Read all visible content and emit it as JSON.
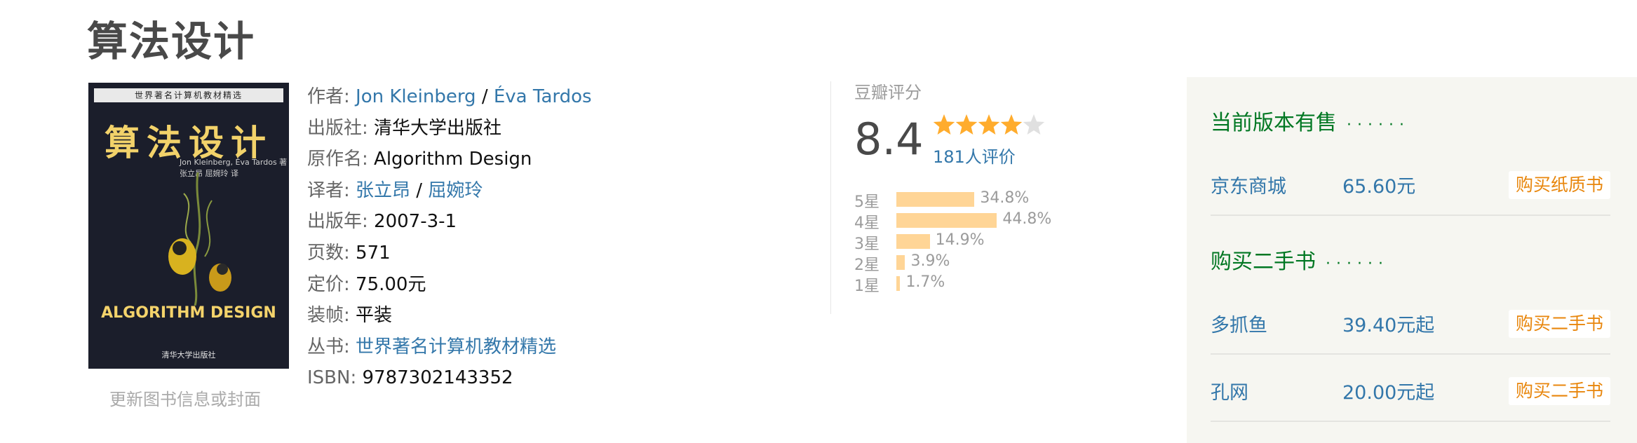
{
  "book": {
    "title": "算法设计"
  },
  "cover": {
    "series_strip": "世界著名计算机教材精选",
    "cn_title": "算法设计",
    "authors_line1": "Jon Kleinberg, Éva Tardos 著",
    "authors_line2": "张立昂 屈婉玲 译",
    "en_title": "ALGORITHM DESIGN",
    "publisher": "清华大学出版社"
  },
  "update_link": "更新图书信息或封面",
  "info": {
    "author_label": "作者:",
    "author_1": "Jon Kleinberg",
    "author_sep": " / ",
    "author_2": "Éva Tardos",
    "publisher_label": "出版社:",
    "publisher": "清华大学出版社",
    "original_title_label": "原作名:",
    "original_title": "Algorithm Design",
    "translator_label": "译者:",
    "translator_1": "张立昂",
    "translator_sep": " / ",
    "translator_2": "屈婉玲",
    "pub_year_label": "出版年:",
    "pub_year": "2007-3-1",
    "pages_label": "页数:",
    "pages": "571",
    "price_label": "定价:",
    "price": "75.00元",
    "binding_label": "装帧:",
    "binding": "平装",
    "series_label": "丛书:",
    "series": "世界著名计算机教材精选",
    "isbn_label": "ISBN:",
    "isbn": "9787302143352"
  },
  "rating": {
    "label": "豆瓣评分",
    "score": "8.4",
    "stars": 4,
    "count": "181人评价",
    "distribution": [
      {
        "label": "5星",
        "percent": "34.8%",
        "value": 34.8
      },
      {
        "label": "4星",
        "percent": "44.8%",
        "value": 44.8
      },
      {
        "label": "3星",
        "percent": "14.9%",
        "value": 14.9
      },
      {
        "label": "2星",
        "percent": "3.9%",
        "value": 3.9
      },
      {
        "label": "1星",
        "percent": "1.7%",
        "value": 1.7
      }
    ]
  },
  "buy": {
    "new_title": "当前版本有售",
    "new_offers": [
      {
        "store": "京东商城",
        "price": "65.60元",
        "button": "购买纸质书"
      }
    ],
    "used_title": "购买二手书",
    "used_offers": [
      {
        "store": "多抓鱼",
        "price": "39.40元起",
        "button": "购买二手书"
      },
      {
        "store": "孔网",
        "price": "20.00元起",
        "button": "购买二手书"
      }
    ]
  },
  "colors": {
    "link": "#3377aa",
    "section_green": "#007722",
    "star": "#ffac2d",
    "bar": "#ffd596",
    "buy_button_text": "#e8860c"
  }
}
